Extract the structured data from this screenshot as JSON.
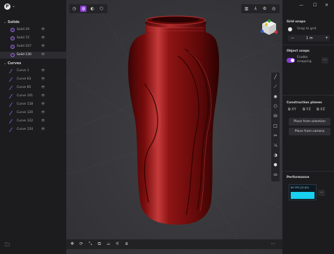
{
  "app": {
    "logo_letter": "P"
  },
  "tree": {
    "solids_header": "Solids",
    "solids": [
      {
        "label": "Solid 29",
        "eye": "👁",
        "active": false
      },
      {
        "label": "Solid 72",
        "eye": "👁",
        "active": false
      },
      {
        "label": "Solid 107",
        "eye": "👁",
        "active": false
      },
      {
        "label": "Solid 130",
        "eye": "👁",
        "active": true
      }
    ],
    "curves_header": "Curves",
    "curves": [
      {
        "label": "Curve 1",
        "eye": "👁"
      },
      {
        "label": "Curve 63",
        "eye": "👁"
      },
      {
        "label": "Curve 85",
        "eye": "👁"
      },
      {
        "label": "Curve 101",
        "eye": "👁"
      },
      {
        "label": "Curve 118",
        "eye": "👁"
      },
      {
        "label": "Curve 120",
        "eye": "👁"
      },
      {
        "label": "Curve 122",
        "eye": "👁"
      },
      {
        "label": "Curve 124",
        "eye": "👁"
      }
    ]
  },
  "right_panel": {
    "grid_snaps_title": "Grid snaps",
    "snap_to_grid_label": "Snap to grid",
    "grid_value": "1 m",
    "minus": "−",
    "plus": "+",
    "object_snaps_title": "Object snaps",
    "enable_snapping_label": "Enable snapping",
    "more": "···",
    "construction_planes_title": "Construction planes",
    "plane_xy": "XY",
    "plane_yz": "YZ",
    "plane_xz": "XZ",
    "place_from_selection": "Place from selection",
    "place_from_camera": "Place from camera",
    "performance_title": "Performance",
    "fps_label": "60 FPS (52-60)"
  },
  "colors": {
    "accent": "#8c3bd9",
    "model": "#8e1414",
    "perf_bar": "#18d0f0"
  }
}
